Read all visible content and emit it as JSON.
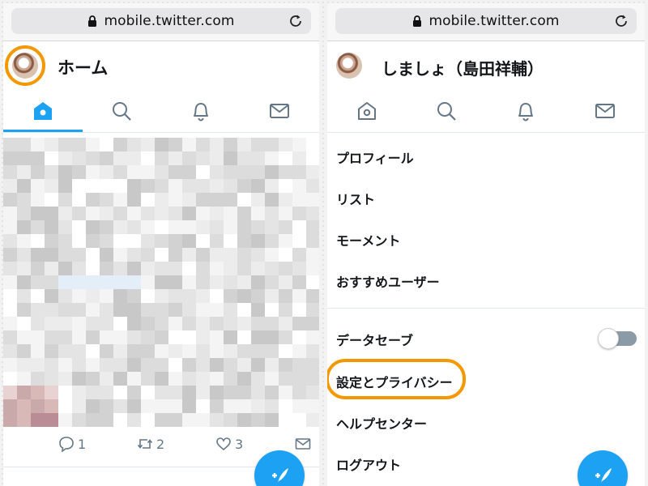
{
  "colors": {
    "accent": "#1da1f2",
    "highlight": "#f39800",
    "text_primary": "#14171a",
    "text_secondary": "#657786"
  },
  "left_screen": {
    "browser": {
      "url": "mobile.twitter.com",
      "lock_icon": "lock-icon",
      "reload_icon": "reload-icon"
    },
    "header": {
      "title": "ホーム",
      "avatar_highlighted": true
    },
    "tabs": [
      {
        "icon": "home-icon",
        "active": true
      },
      {
        "icon": "search-icon",
        "active": false
      },
      {
        "icon": "bell-icon",
        "active": false
      },
      {
        "icon": "mail-icon",
        "active": false
      }
    ],
    "tweet_actions": {
      "reply_count": "1",
      "retweet_count": "2",
      "like_count": "3"
    },
    "compose_icon": "compose-icon"
  },
  "right_screen": {
    "browser": {
      "url": "mobile.twitter.com",
      "lock_icon": "lock-icon",
      "reload_icon": "reload-icon"
    },
    "header": {
      "title": "しましょ（島田祥輔）"
    },
    "tabs": [
      {
        "icon": "home-icon",
        "active": false
      },
      {
        "icon": "search-icon",
        "active": false
      },
      {
        "icon": "bell-icon",
        "active": false
      },
      {
        "icon": "mail-icon",
        "active": false
      }
    ],
    "menu": {
      "profile": "プロフィール",
      "lists": "リスト",
      "moments": "モーメント",
      "recommended_users": "おすすめユーザー",
      "data_saver": "データセーブ",
      "data_saver_on": false,
      "settings_privacy": "設定とプライバシー",
      "settings_highlighted": true,
      "help_center": "ヘルプセンター",
      "logout": "ログアウト"
    },
    "compose_icon": "compose-icon"
  }
}
